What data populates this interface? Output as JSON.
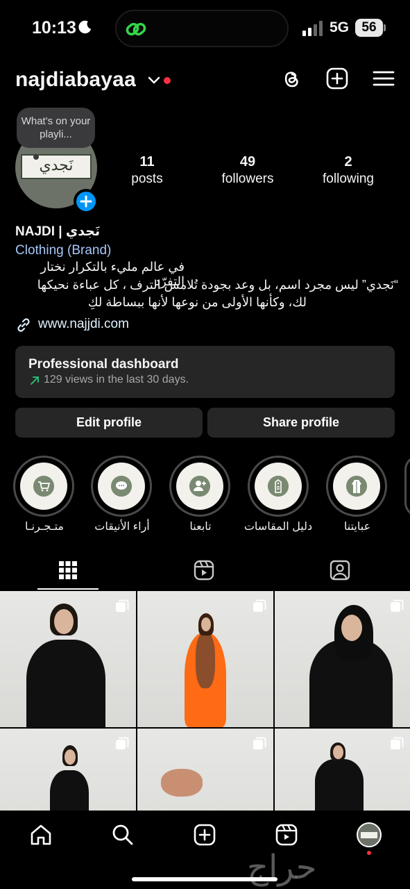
{
  "status_bar": {
    "time": "10:13",
    "network": "5G",
    "battery": "56"
  },
  "header": {
    "username": "najdiabayaa"
  },
  "profile": {
    "note": "What's on your playli...",
    "stats": [
      {
        "num": "11",
        "label": "posts"
      },
      {
        "num": "49",
        "label": "followers"
      },
      {
        "num": "2",
        "label": "following"
      }
    ],
    "name": "NAJDI | نَجدي",
    "category": "Clothing (Brand)",
    "bio": [
      "في عالم مليء بالتكرار نختار التفرّد",
      "“نَجدي” ليس مجرد اسم، بل وعد بجودة تُلامس الترف ، كل عباءة نحيكها",
      "لك، وكأنها الأولى من نوعها لأنها ببساطة لكِ"
    ],
    "link": "www.najjdi.com",
    "avatar_text": "نَجدي"
  },
  "dashboard": {
    "title": "Professional dashboard",
    "subtitle": "129 views in the last 30 days."
  },
  "buttons": {
    "edit": "Edit profile",
    "share": "Share profile"
  },
  "highlights": [
    {
      "label": "متـجـرنـا",
      "icon": "cart-icon"
    },
    {
      "label": "أراء الأنيقات",
      "icon": "chat-icon"
    },
    {
      "label": "تابعنا",
      "icon": "add-user-icon"
    },
    {
      "label": "دليل المقاسات",
      "icon": "size-tag-icon"
    },
    {
      "label": "عبايتنا",
      "icon": "abaya-icon"
    }
  ],
  "colors": {
    "accent_blue": "#0095f6",
    "link_blue": "#a8c7fa",
    "notification_red": "#ff3040",
    "surface": "#262626"
  },
  "watermark": "حراج"
}
